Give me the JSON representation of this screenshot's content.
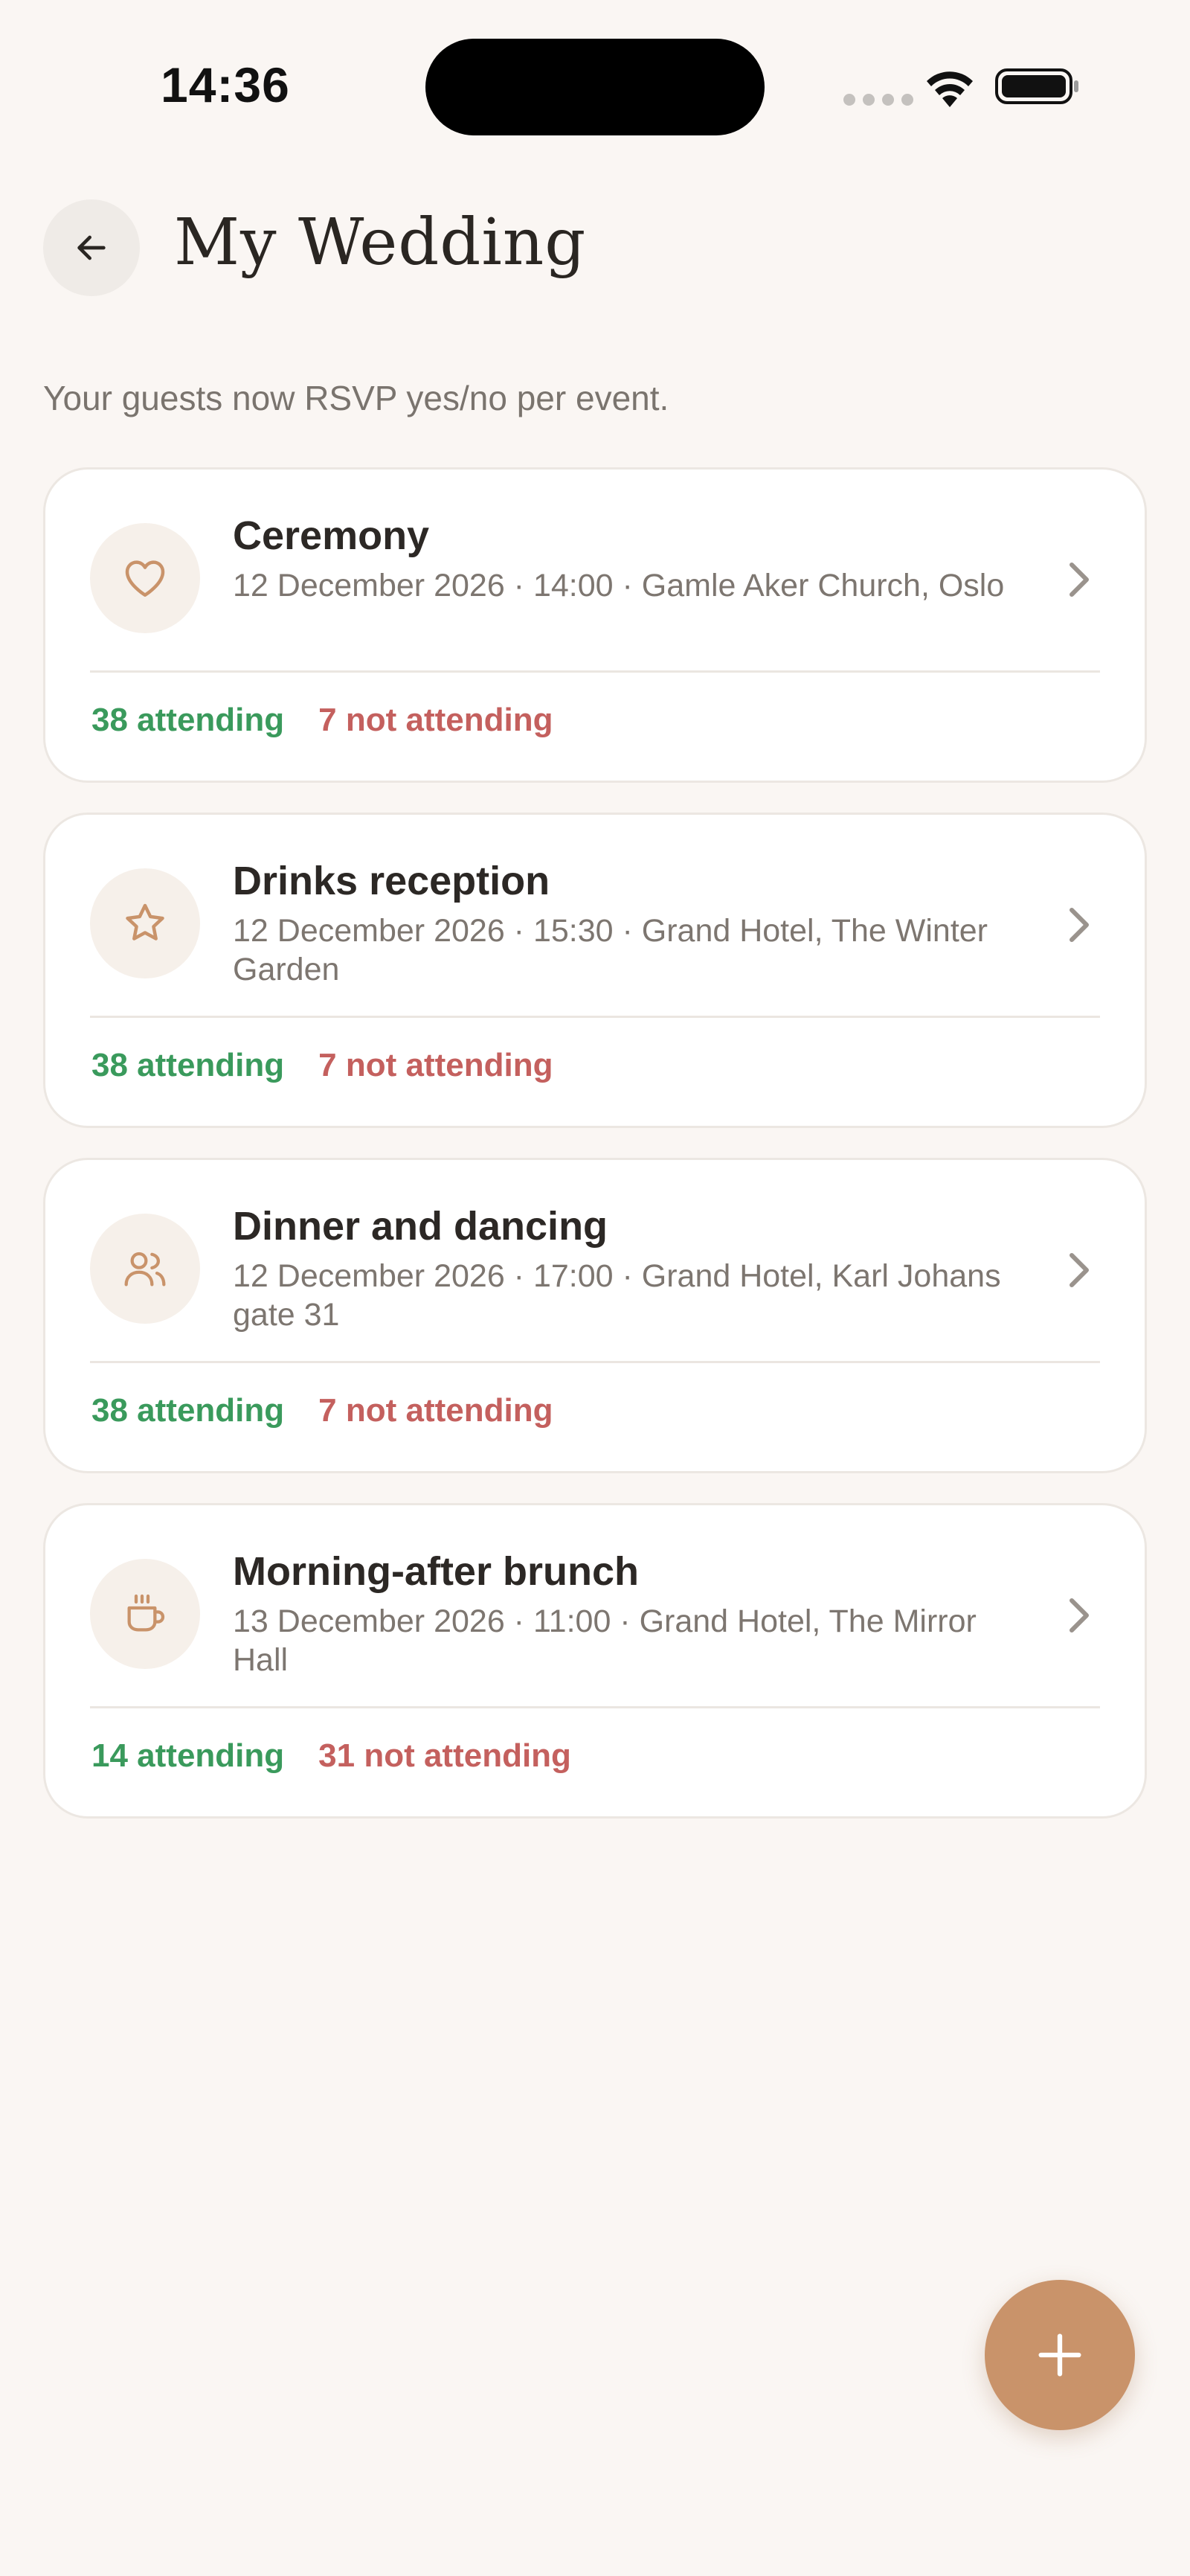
{
  "status_bar": {
    "time": "14:36"
  },
  "header": {
    "back_icon": "arrow-left-icon",
    "title": "My Wedding"
  },
  "subtitle": "Your guests now RSVP yes/no per event.",
  "colors": {
    "background": "#faf6f3",
    "accent": "#c9936a",
    "attending": "#3a9a5c",
    "not_attending": "#c4605e"
  },
  "events": [
    {
      "icon": "heart-icon",
      "title": "Ceremony",
      "details": "12 December 2026 · 14:00 · Gamle Aker Church, Oslo",
      "attending": "38 attending",
      "not_attending": "7 not attending"
    },
    {
      "icon": "star-icon",
      "title": "Drinks reception",
      "details": "12 December 2026 · 15:30 · Grand Hotel, The Winter Garden",
      "attending": "38 attending",
      "not_attending": "7 not attending"
    },
    {
      "icon": "users-icon",
      "title": "Dinner and dancing",
      "details": "12 December 2026 · 17:00 · Grand Hotel, Karl Johans gate 31",
      "attending": "38 attending",
      "not_attending": "7 not attending"
    },
    {
      "icon": "coffee-cup-icon",
      "title": "Morning-after brunch",
      "details": "13 December 2026 · 11:00 · Grand Hotel, The Mirror Hall",
      "attending": "14 attending",
      "not_attending": "31 not attending"
    }
  ],
  "fab": {
    "icon": "plus-icon"
  }
}
